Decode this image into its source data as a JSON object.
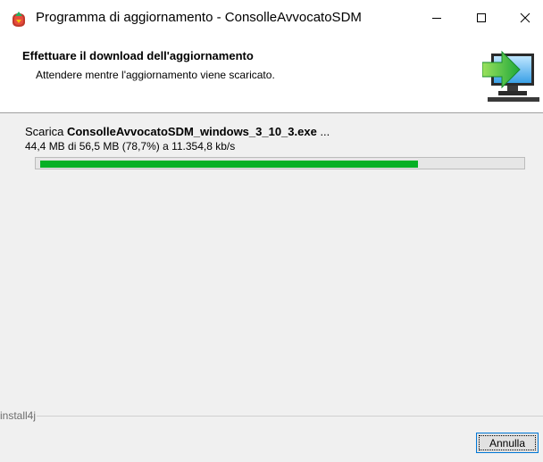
{
  "window": {
    "title": "Programma di aggiornamento - ConsolleAvvocatoSDM",
    "minimize_label": "",
    "maximize_label": "",
    "close_label": ""
  },
  "header": {
    "title": "Effettuare il download dell'aggiornamento",
    "subtitle": "Attendere mentre l'aggiornamento viene scaricato.",
    "icon": "monitor-download-icon"
  },
  "download": {
    "prefix": "Scarica ",
    "filename": "ConsolleAvvocatoSDM_windows_3_10_3.exe",
    "suffix": " ...",
    "stats": "44,4 MB di 56,5 MB (78,7%) a 11.354,8 kb/s",
    "progress_fraction": 0.787,
    "progress_color": "#06b025"
  },
  "footer": {
    "brand": "install4j",
    "cancel_label": "Annulla"
  }
}
